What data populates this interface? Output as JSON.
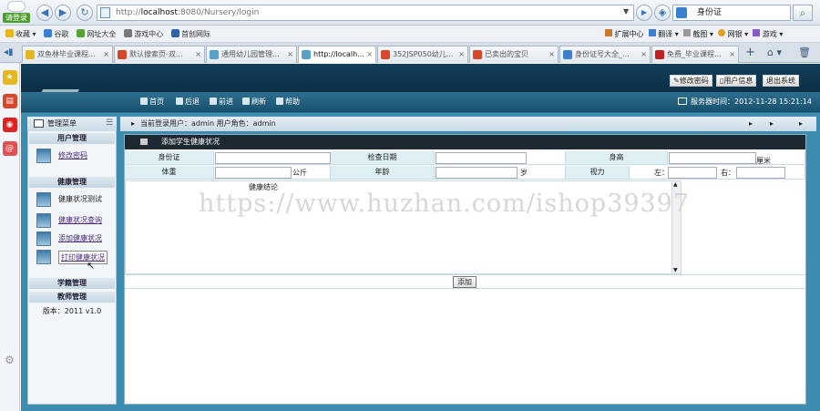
{
  "browser": {
    "login_label": "请登录",
    "address_host": "localhost",
    "address_prefix": "http://",
    "address_rest": ":8080/Nursery/login",
    "search_text": "身份证",
    "favorites": [
      "收藏",
      "谷歌",
      "网址大全",
      "游戏中心",
      "首创网际"
    ],
    "right_tools": [
      "扩展中心",
      "翻译",
      "截图",
      "网银",
      "游戏"
    ],
    "tabs": [
      "双鱼林毕业课程...",
      "默认搜索页-双...",
      "通用幼儿园管理...",
      "http://localh...",
      "352JSP050幼儿...",
      "已卖出的宝贝",
      "身份证号大全_...",
      "免费_毕业课程..."
    ]
  },
  "header": {
    "buttons": [
      "修改密码",
      "用户信息",
      "退出系统"
    ],
    "nav": [
      "首页",
      "后退",
      "前进",
      "刷新",
      "帮助"
    ],
    "server_time": "服务器时间：2012-11-28 15:21:14"
  },
  "menu": {
    "title": "管理菜单",
    "sections": {
      "user": "用户管理",
      "health": "健康管理",
      "course": "学籍管理",
      "teacher": "教师管理"
    },
    "items": {
      "change_password": "修改密码",
      "health_test": "健康状况测试",
      "health_query": "健康状况查询",
      "health_add": "添加健康状况",
      "health_print": "打印健康状况"
    },
    "version": "版本：2011 v1.0"
  },
  "crumb": {
    "text": "当前登录用户：admin  用户角色：admin"
  },
  "form": {
    "title": "添加学生健康状况",
    "labels": {
      "id": "身份证",
      "date": "检查日期",
      "height": "身高",
      "weight": "体重",
      "age": "年龄",
      "vision": "视力",
      "conclusion": "健康结论"
    },
    "units": {
      "height": "厘米",
      "weight": "公斤",
      "age": "岁",
      "left": "左：",
      "right": "右："
    },
    "submit": "添加"
  },
  "watermark": "https://www.huzhan.com/ishop39397"
}
